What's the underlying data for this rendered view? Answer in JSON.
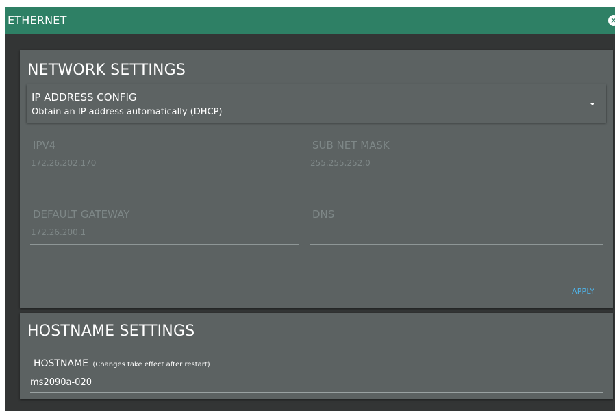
{
  "titlebar": {
    "title": "ETHERNET",
    "close_icon": "close-icon"
  },
  "network": {
    "title": "NETWORK SETTINGS",
    "ip_config": {
      "label": "IP ADDRESS CONFIG",
      "value": "Obtain an IP address automatically (DHCP)",
      "icon": "caret-down-icon"
    },
    "ipv4": {
      "label": "IPV4",
      "value": "172.26.202.170"
    },
    "subnet": {
      "label": "SUB NET MASK",
      "value": "255.255.252.0"
    },
    "gateway": {
      "label": "DEFAULT GATEWAY",
      "value": "172.26.200.1"
    },
    "dns": {
      "label": "DNS",
      "value": ""
    },
    "apply_label": "APPLY"
  },
  "hostname": {
    "title": "HOSTNAME SETTINGS",
    "label": "HOSTNAME",
    "note": "(Changes take effect after restart)",
    "value": "ms2090a-020"
  },
  "colors": {
    "titlebar": "#2e8065",
    "background": "#333535",
    "card": "#5c6262",
    "accent_link": "#4fb3e8",
    "disabled_text": "#7e8787"
  }
}
